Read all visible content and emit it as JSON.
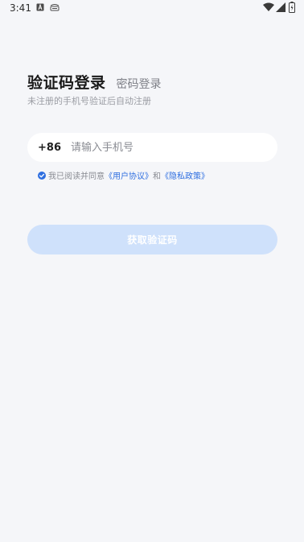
{
  "status_bar": {
    "time": "3:41",
    "icons": [
      "a-notification-icon",
      "b-notification-icon",
      "wifi-icon",
      "signal-icon",
      "battery-icon"
    ]
  },
  "header": {
    "active_tab": "验证码登录",
    "inactive_tab": "密码登录",
    "subtitle": "未注册的手机号验证后自动注册"
  },
  "phone": {
    "country_code": "+86",
    "placeholder": "请输入手机号",
    "value": ""
  },
  "agreement": {
    "checked": true,
    "prefix": "我已阅读并同意",
    "user_agreement": "《用户协议》",
    "conjunction": "和",
    "privacy_policy": "《隐私政策》"
  },
  "button": {
    "label": "获取验证码",
    "enabled": false
  },
  "colors": {
    "background": "#f5f6f9",
    "accent": "#2f6fe0",
    "button_disabled": "#cfe1fb"
  }
}
